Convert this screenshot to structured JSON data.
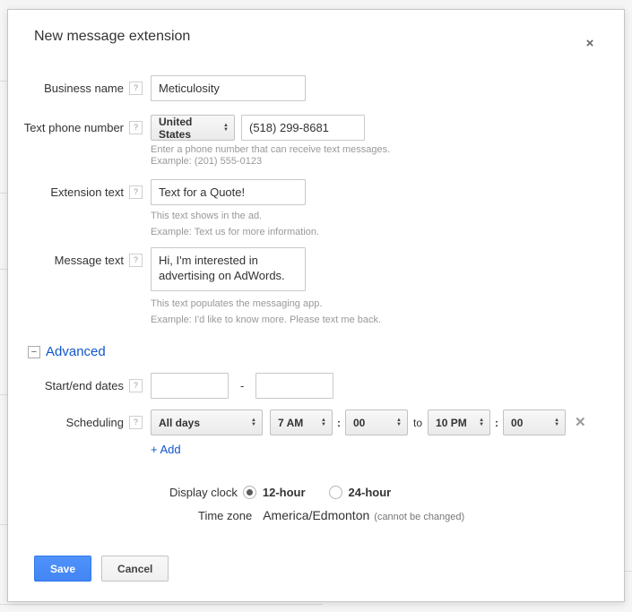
{
  "dialog": {
    "title": "New message extension"
  },
  "icons": {
    "help": "?",
    "close": "×",
    "collapse": "−",
    "arrow_up": "▲",
    "arrow_down": "▼",
    "remove": "✕"
  },
  "fields": {
    "business_name": {
      "label": "Business name",
      "value": "Meticulosity"
    },
    "phone": {
      "label": "Text phone number",
      "country": "United States",
      "number": "(518) 299-8681",
      "help1": "Enter a phone number that can receive text messages.",
      "help2": "Example: (201) 555-0123"
    },
    "extension_text": {
      "label": "Extension text",
      "value": "Text for a Quote!",
      "help1": "This text shows in the ad.",
      "help2": "Example: Text us for more information."
    },
    "message_text": {
      "label": "Message text",
      "value": "Hi, I'm interested in advertising on AdWords.",
      "help1": "This text populates the messaging app.",
      "help2": "Example: I'd like to know more. Please text me back."
    }
  },
  "advanced": {
    "label": "Advanced",
    "start_end": {
      "label": "Start/end dates",
      "separator": "-"
    },
    "scheduling": {
      "label": "Scheduling",
      "days": "All days",
      "start_hour": "7 AM",
      "start_min": "00",
      "colon": ":",
      "to": "to",
      "end_hour": "10 PM",
      "end_min": "00",
      "add": "+ Add"
    },
    "display_clock": {
      "label": "Display clock",
      "option_12": "12-hour",
      "option_24": "24-hour",
      "selected": "12-hour"
    },
    "time_zone": {
      "label": "Time zone",
      "value": "America/Edmonton",
      "note": "(cannot be changed)"
    }
  },
  "buttons": {
    "save": "Save",
    "cancel": "Cancel"
  },
  "colors": {
    "accent_blue": "#4285f4",
    "link_blue": "#1155cc",
    "helper_gray": "#999999"
  }
}
